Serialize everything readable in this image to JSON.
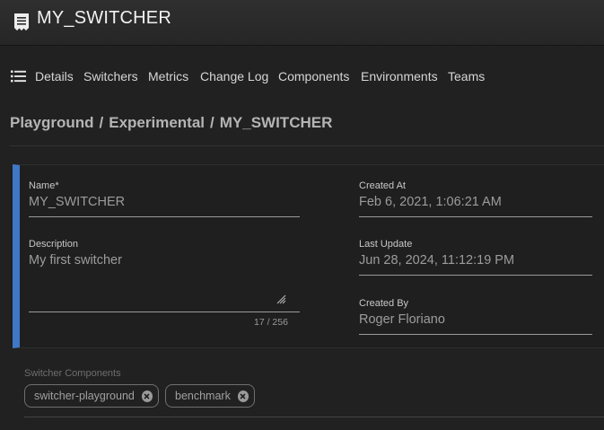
{
  "header": {
    "title": "MY_SWITCHER",
    "icon": "document-icon"
  },
  "tabs": [
    {
      "label": "Details"
    },
    {
      "label": "Switchers"
    },
    {
      "label": "Metrics"
    },
    {
      "label": "Change Log"
    },
    {
      "label": "Components"
    },
    {
      "label": "Environments"
    },
    {
      "label": "Teams"
    }
  ],
  "breadcrumb": {
    "parts": [
      "Playground",
      "Experimental",
      "MY_SWITCHER"
    ],
    "separator": "/"
  },
  "form": {
    "name_label": "Name*",
    "name_value": "MY_SWITCHER",
    "description_label": "Description",
    "description_value": "My first switcher",
    "description_counter": "17 / 256",
    "created_at_label": "Created At",
    "created_at_value": "Feb 6, 2021, 1:06:21 AM",
    "last_update_label": "Last Update",
    "last_update_value": "Jun 28, 2024, 11:12:19 PM",
    "created_by_label": "Created By",
    "created_by_value": "Roger Floriano"
  },
  "components": {
    "label": "Switcher Components",
    "chips": [
      {
        "label": "switcher-playground"
      },
      {
        "label": "benchmark"
      }
    ]
  },
  "colors": {
    "accent": "#3f78c6",
    "background": "#212121"
  }
}
